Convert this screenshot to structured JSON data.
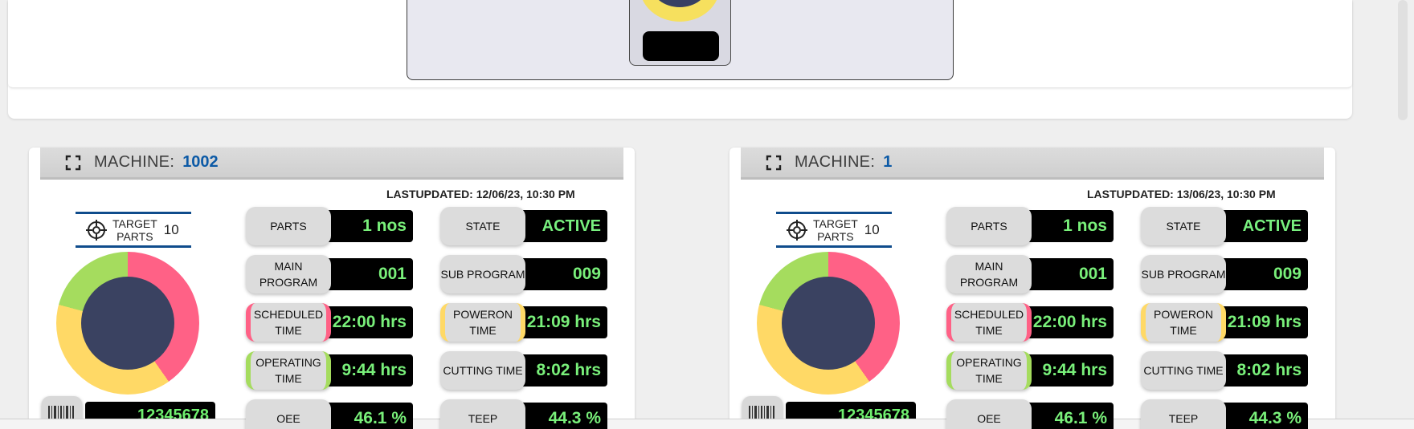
{
  "top": {
    "preview": {
      "gauge_colors": [
        "#ff6b6b",
        "#f6e05e",
        "#7ccc55"
      ]
    }
  },
  "machines": [
    {
      "label": "MACHINE:",
      "id": "1002",
      "last_updated": "LASTUPDATED: 12/06/23, 10:30 PM",
      "target": {
        "label_line1": "TARGET",
        "label_line2": "PARTS",
        "value": "10"
      },
      "barcode": "12345678",
      "donut": {
        "colors": [
          "#ff6186",
          "#ffd966",
          "#a5dc5e"
        ]
      },
      "metrics_left": [
        {
          "label": "PARTS",
          "value": "1 nos"
        },
        {
          "label": "MAIN PROGRAM",
          "value": "001"
        },
        {
          "label": "SCHEDULED TIME",
          "value": "22:00 hrs"
        },
        {
          "label": "OPERATING TIME",
          "value": "9:44 hrs"
        },
        {
          "label": "OEE",
          "value": "46.1 %"
        }
      ],
      "metrics_right": [
        {
          "label": "STATE",
          "value": "ACTIVE"
        },
        {
          "label": "SUB PROGRAM",
          "value": "009"
        },
        {
          "label": "POWERON TIME",
          "value": "21:09 hrs"
        },
        {
          "label": "CUTTING TIME",
          "value": "8:02 hrs"
        },
        {
          "label": "TEEP",
          "value": "44.3 %"
        }
      ]
    },
    {
      "label": "MACHINE:",
      "id": "1",
      "last_updated": "LASTUPDATED: 13/06/23, 10:30 PM",
      "target": {
        "label_line1": "TARGET",
        "label_line2": "PARTS",
        "value": "10"
      },
      "barcode": "12345678",
      "donut": {
        "colors": [
          "#ff6186",
          "#ffd966",
          "#a5dc5e"
        ]
      },
      "metrics_left": [
        {
          "label": "PARTS",
          "value": "1 nos"
        },
        {
          "label": "MAIN PROGRAM",
          "value": "001"
        },
        {
          "label": "SCHEDULED TIME",
          "value": "22:00 hrs"
        },
        {
          "label": "OPERATING TIME",
          "value": "9:44 hrs"
        },
        {
          "label": "OEE",
          "value": "46.1 %"
        }
      ],
      "metrics_right": [
        {
          "label": "STATE",
          "value": "ACTIVE"
        },
        {
          "label": "SUB PROGRAM",
          "value": "009"
        },
        {
          "label": "POWERON TIME",
          "value": "21:09 hrs"
        },
        {
          "label": "CUTTING TIME",
          "value": "8:02 hrs"
        },
        {
          "label": "TEEP",
          "value": "44.3 %"
        }
      ]
    }
  ],
  "icons": {
    "fullscreen": "fullscreen-icon",
    "target": "crosshair-icon",
    "barcode": "barcode-icon"
  }
}
